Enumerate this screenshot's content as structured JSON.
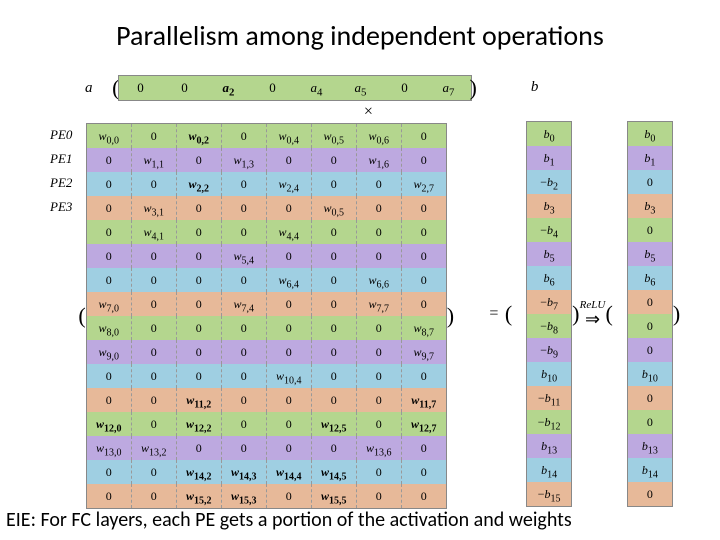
{
  "title": "Parallelism among independent operations",
  "caption": "EIE: For FC layers, each PE gets a portion of the activation and weights",
  "labels": {
    "a_vec": "a⃗",
    "b_vec": "b⃗",
    "mul": "×",
    "eq": "=",
    "relu": "ReLU",
    "arrow": "⇒",
    "pe": [
      "PE0",
      "PE1",
      "PE2",
      "PE3"
    ]
  },
  "chart_data": {
    "type": "table",
    "colors": [
      "green",
      "purple",
      "blue",
      "orange"
    ],
    "color_meaning": "row color = PE assignment; rows cycle PE0..PE3",
    "a": [
      "0",
      "0",
      "a_2",
      "0",
      "a_4",
      "a_5",
      "0",
      "a_7"
    ],
    "a_bold": [
      false,
      false,
      true,
      false,
      false,
      false,
      false,
      false
    ],
    "W_rows": [
      [
        "w_0,0",
        "0",
        "w_0,2",
        "0",
        "w_0,4",
        "w_0,5",
        "w_0,6",
        "0"
      ],
      [
        "0",
        "w_1,1",
        "0",
        "w_1,3",
        "0",
        "0",
        "w_1,6",
        "0"
      ],
      [
        "0",
        "0",
        "w_2,2",
        "0",
        "w_2,4",
        "0",
        "0",
        "w_2,7"
      ],
      [
        "0",
        "w_3,1",
        "0",
        "0",
        "0",
        "w_0,5",
        "0",
        "0"
      ],
      [
        "0",
        "w_4,1",
        "0",
        "0",
        "w_4,4",
        "0",
        "0",
        "0"
      ],
      [
        "0",
        "0",
        "0",
        "w_5,4",
        "0",
        "0",
        "0",
        "0"
      ],
      [
        "0",
        "0",
        "0",
        "0",
        "w_6,4",
        "0",
        "w_6,6",
        "0"
      ],
      [
        "w_7,0",
        "0",
        "0",
        "w_7,4",
        "0",
        "0",
        "w_7,7",
        "0"
      ],
      [
        "w_8,0",
        "0",
        "0",
        "0",
        "0",
        "0",
        "0",
        "w_8,7"
      ],
      [
        "w_9,0",
        "0",
        "0",
        "0",
        "0",
        "0",
        "0",
        "w_9,7"
      ],
      [
        "0",
        "0",
        "0",
        "0",
        "w_10,4",
        "0",
        "0",
        "0"
      ],
      [
        "0",
        "0",
        "w_11,2",
        "0",
        "0",
        "0",
        "0",
        "w_11,7"
      ],
      [
        "w_12,0",
        "0",
        "w_12,2",
        "0",
        "0",
        "w_12,5",
        "0",
        "w_12,7"
      ],
      [
        "w_13,0",
        "w_13,2",
        "0",
        "0",
        "0",
        "0",
        "w_13,6",
        "0"
      ],
      [
        "0",
        "0",
        "w_14,2",
        "w_14,3",
        "w_14,4",
        "w_14,5",
        "0",
        "0"
      ],
      [
        "0",
        "0",
        "w_15,2",
        "w_15,3",
        "0",
        "w_15,5",
        "0",
        "0"
      ]
    ],
    "W_bold_col": 2,
    "W_row_bold": {
      "11": true,
      "12": true,
      "14": true,
      "15": true
    },
    "b_pre": [
      "b_0",
      "b_1",
      "-b_2",
      "b_3",
      "-b_4",
      "b_5",
      "b_6",
      "-b_7",
      "-b_8",
      "-b_9",
      "b_10",
      "-b_11",
      "-b_12",
      "b_13",
      "b_14",
      "-b_15"
    ],
    "b_post": [
      "b_0",
      "b_1",
      "0",
      "b_3",
      "0",
      "b_5",
      "b_6",
      "0",
      "0",
      "0",
      "b_10",
      "0",
      "0",
      "b_13",
      "b_14",
      "0"
    ]
  }
}
